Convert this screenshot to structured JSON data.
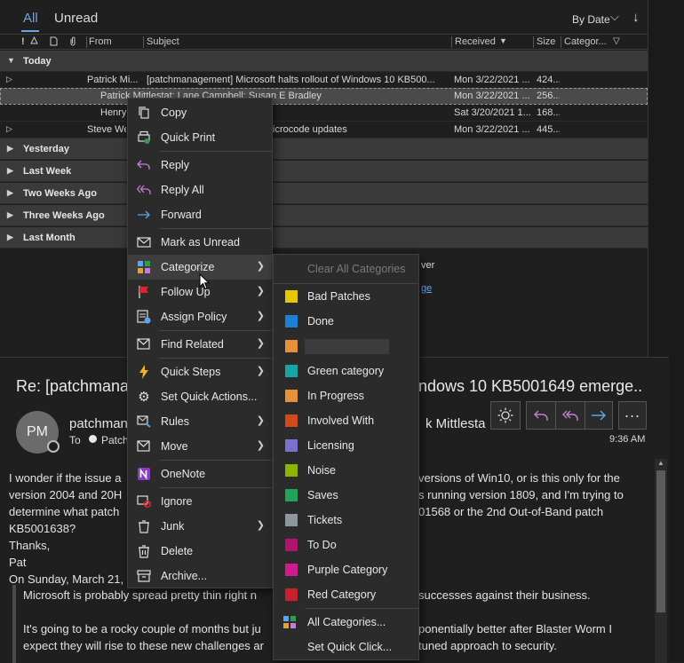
{
  "tabs": {
    "all": "All",
    "unread": "Unread",
    "sort": "By Date",
    "sort_chevron": "⌵",
    "sort_arrow": "↓"
  },
  "columns": {
    "from": "From",
    "subject": "Subject",
    "received": "Received",
    "size": "Size",
    "category": "Categor..."
  },
  "groups": {
    "today": "Today",
    "yesterday": "Yesterday",
    "last_week": "Last Week",
    "two_weeks": "Two Weeks Ago",
    "three_weeks": "Three Weeks Ago",
    "last_month": "Last Month"
  },
  "rows": [
    {
      "from": "Patrick Mi...",
      "subject": "[patchmanagement] Microsoft halts rollout of Windows 10 KB500...",
      "received": "Mon 3/22/2021 ...",
      "size": "424..."
    },
    {
      "from": "Patrick Mittlestat; Lane Campbell; Susan E Bradley",
      "subject": "",
      "received": "Mon 3/22/2021 ...",
      "size": "256..."
    },
    {
      "from": "Henry",
      "subject": "",
      "received": "Sat 3/20/2021 1...",
      "size": "168..."
    },
    {
      "from": "Steve We",
      "subject": "icrocode updates",
      "received": "Mon 3/22/2021 ...",
      "size": "445..."
    }
  ],
  "behind_menu": {
    "ver": "ver",
    "ge": "ge"
  },
  "reading": {
    "subject_left": "Re: [patchmana",
    "subject_right": "ndows 10 KB5001649 emerge...",
    "avatar": "PM",
    "sender": "patchman",
    "sender_right": "k Mittlesta",
    "to_label": "To",
    "to_value": "Patch",
    "time": "9:36 AM",
    "lines": [
      {
        "left": "I wonder if the issue a",
        "right": "versions of Win10, or is this only for the"
      },
      {
        "left": "version 2004 and 20H",
        "right": "s  running version 1809, and I'm trying to"
      },
      {
        "left": "determine what patch",
        "right": "01568 or the 2nd Out-of-Band patch"
      },
      {
        "left": "KB5001638?",
        "right": ""
      },
      {
        "left": "Thanks,",
        "right": ""
      },
      {
        "left": "Pat",
        "right": ""
      },
      {
        "left": "On Sunday, March 21,",
        "right": ""
      }
    ],
    "quote_lines": [
      {
        "left": "Microsoft is probably spread pretty thin right n",
        "right": "successes against their business."
      },
      {
        "left": "It's going to be a rocky couple of months but ju",
        "right": "ponentially better after Blaster Worm I"
      },
      {
        "left": "expect they will rise to these new challenges ar",
        "right": "tuned approach to security."
      }
    ]
  },
  "context_menu": [
    {
      "label": "Copy",
      "icon": "copy-icon"
    },
    {
      "label": "Quick Print",
      "icon": "quick-print-icon"
    },
    {
      "label": "Reply",
      "icon": "reply-icon"
    },
    {
      "label": "Reply All",
      "icon": "reply-all-icon"
    },
    {
      "label": "Forward",
      "icon": "forward-icon"
    },
    {
      "label": "Mark as Unread",
      "icon": "envelope-icon"
    },
    {
      "label": "Categorize",
      "icon": "categorize-icon"
    },
    {
      "label": "Follow Up",
      "icon": "flag-icon"
    },
    {
      "label": "Assign Policy",
      "icon": "policy-icon"
    },
    {
      "label": "Find Related",
      "icon": "find-related-icon"
    },
    {
      "label": "Quick Steps",
      "icon": "lightning-icon"
    },
    {
      "label": "Set Quick Actions...",
      "icon": "gear-icon"
    },
    {
      "label": "Rules",
      "icon": "rules-icon"
    },
    {
      "label": "Move",
      "icon": "move-icon"
    },
    {
      "label": "OneNote",
      "icon": "onenote-icon"
    },
    {
      "label": "Ignore",
      "icon": "ignore-icon"
    },
    {
      "label": "Junk",
      "icon": "junk-icon"
    },
    {
      "label": "Delete",
      "icon": "trash-icon"
    },
    {
      "label": "Archive...",
      "icon": "archive-icon"
    }
  ],
  "categories_menu": {
    "clear": "Clear All Categories",
    "items": [
      {
        "label": "Bad Patches",
        "color": "#e6c800"
      },
      {
        "label": "Done",
        "color": "#1e7fd6"
      },
      {
        "label": "",
        "color": "#e8913a"
      },
      {
        "label": "Green category",
        "color": "#16a5a5"
      },
      {
        "label": "In Progress",
        "color": "#e8913a"
      },
      {
        "label": "Involved With",
        "color": "#d04a1c"
      },
      {
        "label": "Licensing",
        "color": "#7b6fd0"
      },
      {
        "label": "Noise",
        "color": "#8cb400"
      },
      {
        "label": "Saves",
        "color": "#20a35a"
      },
      {
        "label": "Tickets",
        "color": "#8d979c"
      },
      {
        "label": "To Do",
        "color": "#b0146e"
      },
      {
        "label": "Purple Category",
        "color": "#d01a8d"
      },
      {
        "label": "Red Category",
        "color": "#c8202c"
      }
    ],
    "all": "All Categories...",
    "quick": "Set Quick Click..."
  }
}
